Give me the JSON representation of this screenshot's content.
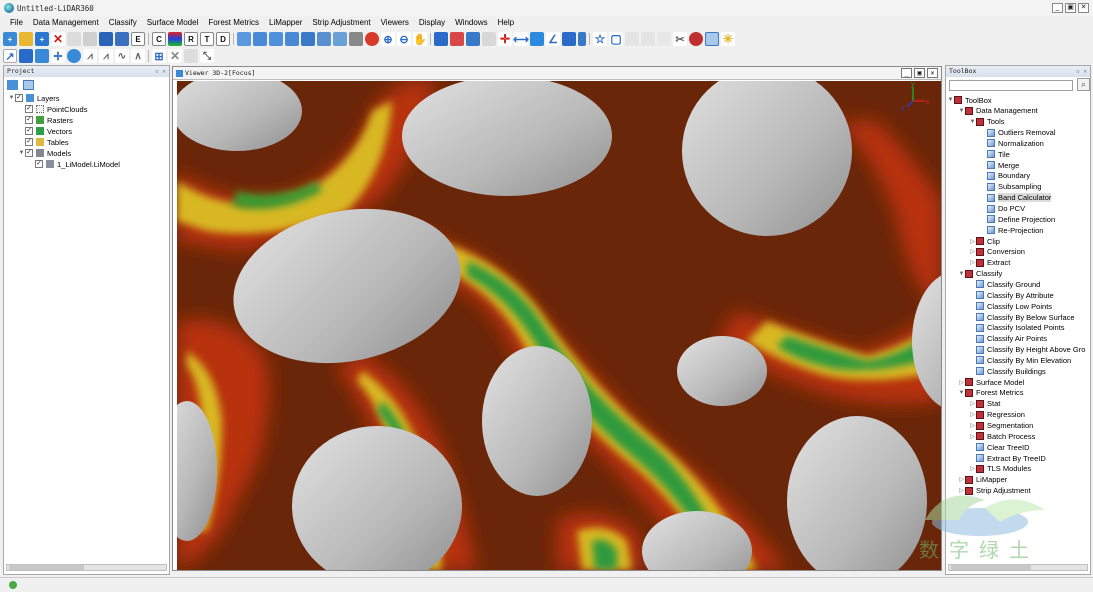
{
  "window": {
    "title": "Untitled-LiDAR360",
    "minimize": "_",
    "restore": "▣",
    "close": "✕"
  },
  "menu": [
    "File",
    "Data Management",
    "Classify",
    "Surface Model",
    "Forest Metrics",
    "LiMapper",
    "Strip Adjustment",
    "Viewers",
    "Display",
    "Windows",
    "Help"
  ],
  "toolbar_letters": {
    "e": "E",
    "c": "C",
    "r": "R",
    "t": "T",
    "d": "D"
  },
  "project": {
    "title": "Project",
    "layers": [
      {
        "label": "Layers",
        "level": 0,
        "icon": "folder-icon",
        "check": true,
        "exp": "▼"
      },
      {
        "label": "PointClouds",
        "level": 1,
        "icon": "pointcloud-icon",
        "check": true,
        "exp": ""
      },
      {
        "label": "Rasters",
        "level": 1,
        "icon": "raster-icon",
        "check": true,
        "exp": ""
      },
      {
        "label": "Vectors",
        "level": 1,
        "icon": "vector-icon",
        "check": true,
        "exp": ""
      },
      {
        "label": "Tables",
        "level": 1,
        "icon": "table-icon",
        "check": true,
        "exp": ""
      },
      {
        "label": "Models",
        "level": 1,
        "icon": "model-icon",
        "check": true,
        "exp": "▼"
      },
      {
        "label": "1_LiModel.LiModel",
        "level": 2,
        "icon": "model-file-icon",
        "check": true,
        "exp": ""
      }
    ]
  },
  "viewer": {
    "title": "Viewer 3D-2[Focus]",
    "axis_x": "x",
    "axis_y": "y",
    "axis_z": "z"
  },
  "toolbox": {
    "title": "ToolBox",
    "search_placeholder": "",
    "items": [
      {
        "label": "ToolBox",
        "level": 0,
        "exp": "▼",
        "kind": "folder"
      },
      {
        "label": "Data Management",
        "level": 1,
        "exp": "▼",
        "kind": "folder"
      },
      {
        "label": "Tools",
        "level": 2,
        "exp": "▼",
        "kind": "folder"
      },
      {
        "label": "Outliers Removal",
        "level": 3,
        "exp": "",
        "kind": "tool"
      },
      {
        "label": "Normalization",
        "level": 3,
        "exp": "",
        "kind": "tool"
      },
      {
        "label": "Tile",
        "level": 3,
        "exp": "",
        "kind": "tool"
      },
      {
        "label": "Merge",
        "level": 3,
        "exp": "",
        "kind": "tool"
      },
      {
        "label": "Boundary",
        "level": 3,
        "exp": "",
        "kind": "tool"
      },
      {
        "label": "Subsampling",
        "level": 3,
        "exp": "",
        "kind": "tool"
      },
      {
        "label": "Band Calculator",
        "level": 3,
        "exp": "",
        "kind": "tool",
        "selected": true
      },
      {
        "label": "Do PCV",
        "level": 3,
        "exp": "",
        "kind": "tool"
      },
      {
        "label": "Define Projection",
        "level": 3,
        "exp": "",
        "kind": "tool"
      },
      {
        "label": "Re-Projection",
        "level": 3,
        "exp": "",
        "kind": "tool"
      },
      {
        "label": "Clip",
        "level": 2,
        "exp": "▷",
        "kind": "folder"
      },
      {
        "label": "Conversion",
        "level": 2,
        "exp": "▷",
        "kind": "folder"
      },
      {
        "label": "Extract",
        "level": 2,
        "exp": "▷",
        "kind": "folder"
      },
      {
        "label": "Classify",
        "level": 1,
        "exp": "▼",
        "kind": "folder"
      },
      {
        "label": "Classify Ground",
        "level": 2,
        "exp": "",
        "kind": "tool"
      },
      {
        "label": "Classify By Attribute",
        "level": 2,
        "exp": "",
        "kind": "tool"
      },
      {
        "label": "Classify Low Points",
        "level": 2,
        "exp": "",
        "kind": "tool"
      },
      {
        "label": "Classify By Below Surface",
        "level": 2,
        "exp": "",
        "kind": "tool"
      },
      {
        "label": "Classify Isolated Points",
        "level": 2,
        "exp": "",
        "kind": "tool"
      },
      {
        "label": "Classify Air Points",
        "level": 2,
        "exp": "",
        "kind": "tool"
      },
      {
        "label": "Classify By Height Above Gro",
        "level": 2,
        "exp": "",
        "kind": "tool"
      },
      {
        "label": "Classify By Min Elevation",
        "level": 2,
        "exp": "",
        "kind": "tool"
      },
      {
        "label": "Classify Buildings",
        "level": 2,
        "exp": "",
        "kind": "tool"
      },
      {
        "label": "Surface Model",
        "level": 1,
        "exp": "▷",
        "kind": "folder"
      },
      {
        "label": "Forest Metrics",
        "level": 1,
        "exp": "▼",
        "kind": "folder"
      },
      {
        "label": "Stat",
        "level": 2,
        "exp": "▷",
        "kind": "folder"
      },
      {
        "label": "Regression",
        "level": 2,
        "exp": "▷",
        "kind": "folder"
      },
      {
        "label": "Segmentation",
        "level": 2,
        "exp": "▷",
        "kind": "folder"
      },
      {
        "label": "Batch Process",
        "level": 2,
        "exp": "▷",
        "kind": "folder"
      },
      {
        "label": "Clear TreeID",
        "level": 2,
        "exp": "",
        "kind": "tool"
      },
      {
        "label": "Extract By TreeID",
        "level": 2,
        "exp": "",
        "kind": "tool"
      },
      {
        "label": "TLS Modules",
        "level": 2,
        "exp": "▷",
        "kind": "folder"
      },
      {
        "label": "LiMapper",
        "level": 1,
        "exp": "▷",
        "kind": "folder"
      },
      {
        "label": "Strip Adjustment",
        "level": 1,
        "exp": "▷",
        "kind": "folder"
      }
    ]
  },
  "watermark": {
    "text": "数字绿土"
  },
  "colors": {
    "terrain_low": "#2e9a3c",
    "terrain_mid": "#d8c028",
    "terrain_high": "#b02808",
    "terrain_base": "#6a2608",
    "blob": "#bdbdbd"
  }
}
